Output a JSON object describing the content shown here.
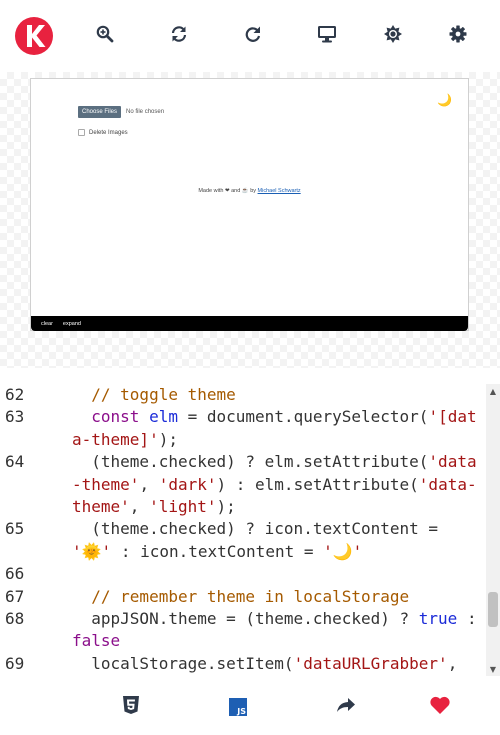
{
  "toolbar": {
    "logo_letter": "K",
    "icons": [
      "zoom-in-icon",
      "refresh-icon",
      "redo-icon",
      "desktop-icon",
      "brightness-icon",
      "settings-icon"
    ],
    "accent": "#e8223f",
    "icon_color": "#2f3a4a"
  },
  "preview": {
    "choose_files": "Choose Files",
    "no_file": "No file chosen",
    "delete_images": "Delete Images",
    "made_with_prefix": "Made with",
    "heart": "❤",
    "and": "and",
    "coffee": "☕",
    "by": "by",
    "author": "Michael Schwartz",
    "moon": "🌙",
    "console_clear": "clear",
    "console_expand": "expand"
  },
  "editor": {
    "lines": [
      {
        "n": "62",
        "segments": [
          {
            "t": "  ",
            "c": ""
          },
          {
            "t": "// toggle theme",
            "c": "c-comment"
          }
        ]
      },
      {
        "n": "63",
        "segments": [
          {
            "t": "  ",
            "c": ""
          },
          {
            "t": "const",
            "c": "c-key"
          },
          {
            "t": " ",
            "c": ""
          },
          {
            "t": "elm",
            "c": "c-var"
          },
          {
            "t": " = document.querySelector(",
            "c": ""
          },
          {
            "t": "'[data-theme]'",
            "c": "c-str"
          },
          {
            "t": ");",
            "c": ""
          }
        ]
      },
      {
        "n": "64",
        "segments": [
          {
            "t": "  (theme.checked) ? elm.setAttribute(",
            "c": ""
          },
          {
            "t": "'data-theme'",
            "c": "c-str"
          },
          {
            "t": ", ",
            "c": ""
          },
          {
            "t": "'dark'",
            "c": "c-str"
          },
          {
            "t": ") : elm.setAttribute(",
            "c": ""
          },
          {
            "t": "'data-theme'",
            "c": "c-str"
          },
          {
            "t": ", ",
            "c": ""
          },
          {
            "t": "'light'",
            "c": "c-str"
          },
          {
            "t": ");",
            "c": ""
          }
        ]
      },
      {
        "n": "65",
        "segments": [
          {
            "t": "  (theme.checked) ? icon.textContent = ",
            "c": ""
          },
          {
            "t": "'🌞'",
            "c": "c-str"
          },
          {
            "t": " : icon.textContent = ",
            "c": ""
          },
          {
            "t": "'🌙'",
            "c": "c-str"
          }
        ]
      },
      {
        "n": "66",
        "segments": [
          {
            "t": "",
            "c": ""
          }
        ]
      },
      {
        "n": "67",
        "segments": [
          {
            "t": "  ",
            "c": ""
          },
          {
            "t": "// remember theme in localStorage",
            "c": "c-comment"
          }
        ]
      },
      {
        "n": "68",
        "segments": [
          {
            "t": "  appJSON.theme = (theme.checked) ? ",
            "c": ""
          },
          {
            "t": "true",
            "c": "c-var"
          },
          {
            "t": " : ",
            "c": ""
          },
          {
            "t": "false",
            "c": "c-key"
          }
        ]
      },
      {
        "n": "69",
        "segments": [
          {
            "t": "  localStorage.setItem(",
            "c": ""
          },
          {
            "t": "'dataURLGrabber'",
            "c": "c-str"
          },
          {
            "t": ",",
            "c": ""
          }
        ]
      }
    ]
  },
  "bottombar": {
    "icons": [
      "html5-icon",
      "javascript-icon",
      "share-icon",
      "heart-icon"
    ],
    "js_label": "JS",
    "heart_color": "#e8223f"
  }
}
